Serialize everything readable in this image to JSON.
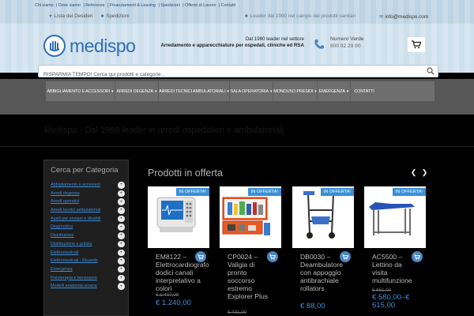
{
  "topbar": {
    "links": [
      "Chi siamo",
      "Dove siamo",
      "Referenze",
      "Finanziamenti & Leasing",
      "Spedizioni",
      "Offerte di Lavoro",
      "Contatti"
    ],
    "wishlist": "Lista dei Desideri",
    "shipping": "Spedizioni",
    "leader": "Leader dal 1980 nel campo dei prodotti sanitari",
    "email": "info@medispo.com"
  },
  "header": {
    "logo_text": "medispo",
    "tagline_1": "Dal 1980 leader nel settore",
    "tagline_2": "Arredamento e apparecchiature per ospedali, cliniche ed RSA",
    "phone_label": "Numero Verde",
    "phone_number": "800 92 29 90"
  },
  "search": {
    "placeholder": "RISPARMIA TEMPO! Cerca qui prodotti e categorie..."
  },
  "nav": {
    "items": [
      {
        "label": "Abbigliamento e accessori",
        "caret": true
      },
      {
        "label": "Arredi degenza",
        "caret": true
      },
      {
        "label": "Arredi tecnici ambulatoriali",
        "caret": true
      },
      {
        "label": "Sala operatoria",
        "caret": true
      },
      {
        "label": "Monouso presidi",
        "caret": true
      },
      {
        "label": "Emergenza",
        "caret": true
      },
      {
        "label": "Contatti",
        "caret": false
      }
    ]
  },
  "banner": {
    "text": "Medispo - Dal 1980 leader in arredi ospedalieri e ambulatoriali"
  },
  "sidebar": {
    "title": "Cerca per Categoria",
    "categories": [
      "Abbigliamento e accessori",
      "Arredi degenza",
      "Arredi operativi",
      "Arredi tecnici ambulatoriali",
      "Ausili per anziani e disabili",
      "Diagnostica",
      "Disinfezione",
      "Distribuzione e pulizia",
      "Elettromedicali",
      "Elettromedicali - Ricambi",
      "Emergenza",
      "Fisioterapia e benessere",
      "Modelli anatomia umana"
    ],
    "toggle_symbol": "+"
  },
  "main": {
    "section_title": "Prodotti in offerta",
    "prev_symbol": "❮",
    "next_symbol": "❯",
    "products": [
      {
        "badge": "IN OFFERTA!",
        "name": "EM8122 – Elettrocardiografo dodici canali interpretativo a colori",
        "old_price": "€ 1.407,00",
        "price": "€ 1.240,00",
        "icon": "ecg-device-image"
      },
      {
        "badge": "IN OFFERTA!",
        "name": "CP0024 – Valigia di pronto soccorso estremo Explorer Plus",
        "old_price": "€ 431,00",
        "price": "",
        "icon": "first-aid-case-image"
      },
      {
        "badge": "IN OFFERTA!",
        "name": "DB0030 – Deambulatore con appoggio antibrachiale rollators",
        "old_price": "",
        "price": "€ 88,00",
        "icon": "rollator-image"
      },
      {
        "badge": "IN OFFERTA!",
        "name": "AC5500 – Lettino da visita multifunzione",
        "old_price": "€ 651,00",
        "price": "€ 580,00–€ 615,00",
        "icon": "exam-table-image"
      }
    ]
  },
  "colors": {
    "accent": "#3a8fd6",
    "nav_bg": "#6e6e6e",
    "link": "#3d8bd9"
  }
}
